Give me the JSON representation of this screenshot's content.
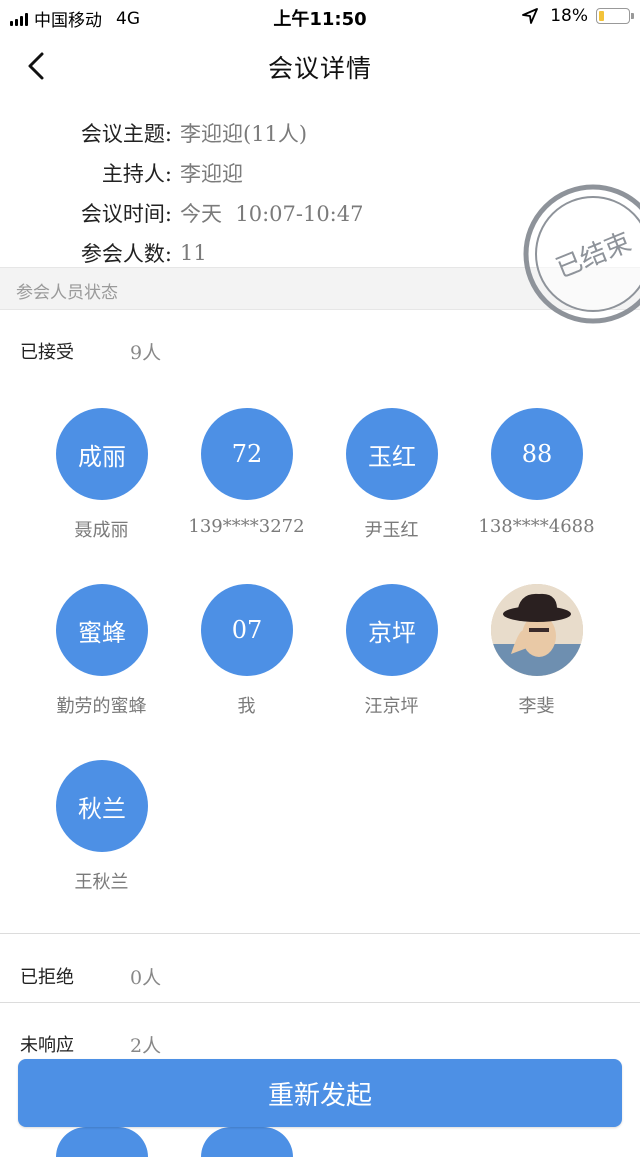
{
  "status_bar": {
    "carrier": "中国移动",
    "network": "4G",
    "time": "上午11:50",
    "battery_pct": "18%",
    "battery_level": 0.18
  },
  "nav": {
    "title": "会议详情",
    "back_icon": "chevron-left-icon"
  },
  "meeting": {
    "topic_label": "会议主题:",
    "topic_value": "李迎迎(11人)",
    "host_label": "主持人:",
    "host_value": "李迎迎",
    "time_label": "会议时间:",
    "time_value": "今天  10:07-10:47",
    "count_label": "参会人数:",
    "count_value": "11"
  },
  "stamp": {
    "text": "已结束",
    "color": "#8e939a"
  },
  "section": {
    "title": "参会人员状态"
  },
  "accepted": {
    "label": "已接受",
    "count": "9人",
    "people": [
      {
        "avatar_text": "成丽",
        "name": "聂成丽"
      },
      {
        "avatar_text": "72",
        "name": "139****3272"
      },
      {
        "avatar_text": "玉红",
        "name": "尹玉红"
      },
      {
        "avatar_text": "88",
        "name": "138****4688"
      },
      {
        "avatar_text": "蜜蜂",
        "name": "勤劳的蜜蜂"
      },
      {
        "avatar_text": "07",
        "name": "我"
      },
      {
        "avatar_text": "京坪",
        "name": "汪京坪"
      },
      {
        "avatar_text": "",
        "name": "李斐",
        "photo": true
      },
      {
        "avatar_text": "秋兰",
        "name": "王秋兰"
      }
    ]
  },
  "rejected": {
    "label": "已拒绝",
    "count": "0人"
  },
  "no_response": {
    "label": "未响应",
    "count": "2人"
  },
  "action": {
    "reinitiate_label": "重新发起"
  },
  "colors": {
    "accent": "#4d90e5",
    "label_gray": "#7b7b7b",
    "battery": "#f3c33a"
  }
}
